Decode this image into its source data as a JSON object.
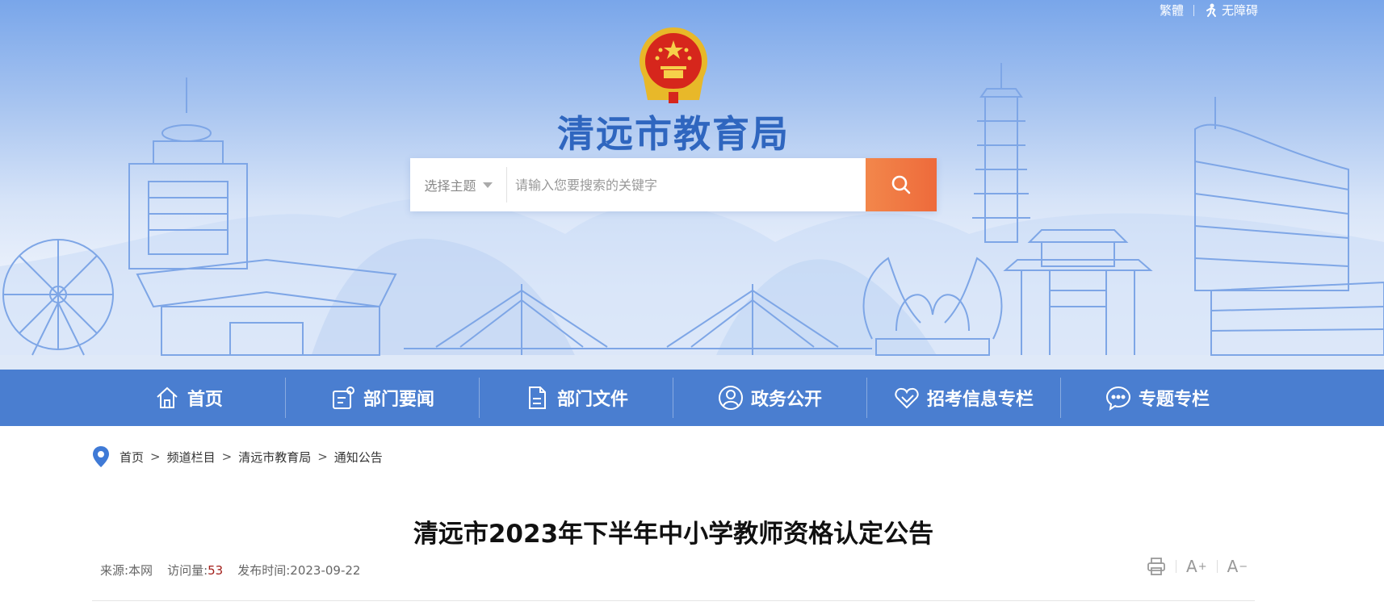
{
  "header": {
    "site_title": "清远市教育局",
    "top_links": {
      "traditional": "繁體",
      "accessibility": "无障碍"
    },
    "search": {
      "topic_label": "选择主题",
      "placeholder": "请输入您要搜索的关键字"
    },
    "colors": {
      "banner_top": "#79a6ea",
      "title": "#2f66bf",
      "search_button": "#ee6a3b"
    }
  },
  "nav": {
    "background": "#4a7ed0",
    "items": [
      {
        "label": "首页",
        "icon": "home-icon"
      },
      {
        "label": "部门要闻",
        "icon": "news-icon"
      },
      {
        "label": "部门文件",
        "icon": "document-icon"
      },
      {
        "label": "政务公开",
        "icon": "user-circle-icon"
      },
      {
        "label": "招考信息专栏",
        "icon": "heart-icon"
      },
      {
        "label": "专题专栏",
        "icon": "chat-bubble-icon"
      }
    ]
  },
  "breadcrumb": {
    "items": [
      "首页",
      "频道栏目",
      "清远市教育局",
      "通知公告"
    ],
    "separator": ">"
  },
  "article": {
    "title": "清远市2023年下半年中小学教师资格认定公告",
    "source_label": "来源:本网",
    "visits_label": "访问量:",
    "visits": "53",
    "date_label": "发布时间:2023-09-22",
    "tools": {
      "enlarge": "A",
      "shrink": "A"
    }
  }
}
